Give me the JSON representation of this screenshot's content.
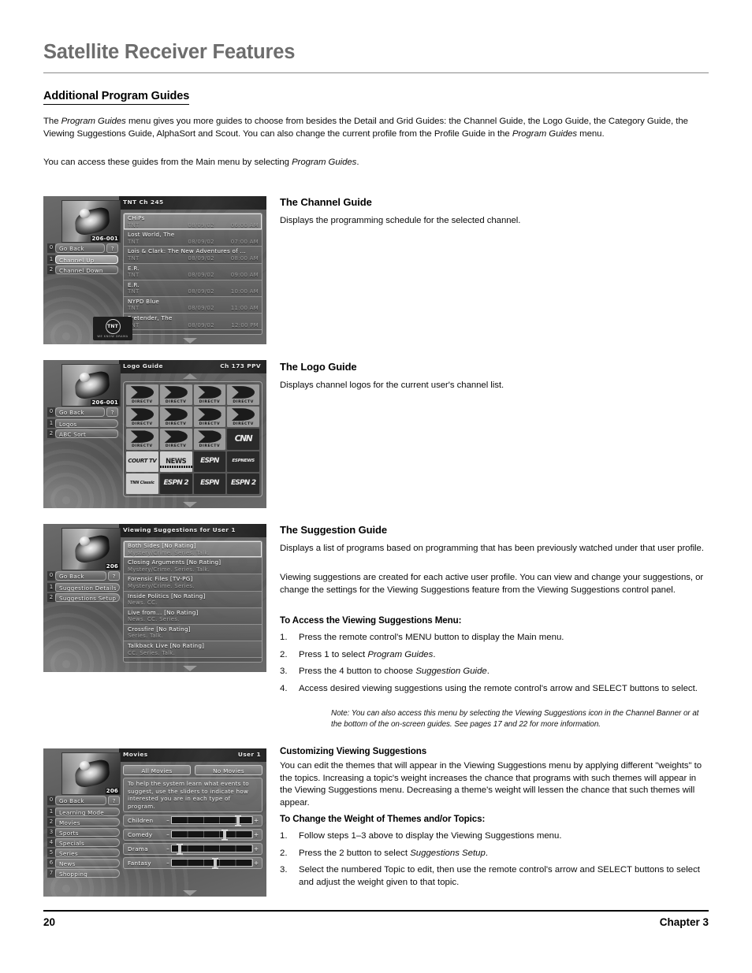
{
  "document": {
    "chapter_title": "Satellite Receiver Features",
    "section_heading": "Additional Program Guides",
    "intro_p1_a": "The ",
    "intro_p1_i1": "Program Guides",
    "intro_p1_b": " menu gives you more guides to choose from besides the Detail and Grid Guides: the Channel Guide, the Logo Guide, the Category Guide, the Viewing Suggestions Guide, AlphaSort and Scout. You can also change the current profile from the Profile Guide in the ",
    "intro_p1_i2": "Program Guides",
    "intro_p1_c": " menu.",
    "intro_p2_a": "You can access these guides from the Main menu by selecting ",
    "intro_p2_i": "Program Guides",
    "intro_p2_b": ".",
    "footer_page": "20",
    "footer_chapter": "Chapter 3"
  },
  "sections": {
    "channel_guide": {
      "heading": "The Channel Guide",
      "body": "Displays the programming schedule for the selected channel."
    },
    "logo_guide": {
      "heading": "The Logo Guide",
      "body": "Displays channel logos for the current user's channel list."
    },
    "suggestion_guide": {
      "heading": "The Suggestion Guide",
      "p1": "Displays a list of programs based on programming that has been previously watched under that user profile.",
      "p2": "Viewing suggestions are created for each active user profile. You can view and change your suggestions, or change the settings for the Viewing Suggestions feature from the Viewing Suggestions control panel.",
      "steps_heading": "To Access the Viewing Suggestions Menu:",
      "steps": [
        {
          "num": "1.",
          "a": "Press the remote control's MENU button to display the Main menu.",
          "i": "",
          "b": ""
        },
        {
          "num": "2.",
          "a": "Press 1 to select ",
          "i": "Program Guides",
          "b": "."
        },
        {
          "num": "3.",
          "a": "Press the 4 button to choose ",
          "i": "Suggestion Guide",
          "b": "."
        },
        {
          "num": "4.",
          "a": "Access desired viewing suggestions using the remote control's arrow and SELECT buttons to select.",
          "i": "",
          "b": ""
        }
      ],
      "note": "Note: You can also access this menu by selecting the Viewing Suggestions icon in the Channel Banner or at the bottom of the on-screen guides. See pages 17 and 22 for more information."
    },
    "customizing": {
      "heading": "Customizing Viewing Suggestions",
      "p1": "You can edit the themes that will appear in the Viewing Suggestions menu by applying different \"weights\" to the topics. Increasing a topic's weight increases the chance that programs with such themes will appear in the Viewing Suggestions menu. Decreasing a theme's weight will lessen the chance that such themes will appear.",
      "steps_heading": "To Change the Weight of Themes and/or Topics:",
      "steps": [
        {
          "num": "1.",
          "a": "Follow steps 1–3 above to display the Viewing Suggestions menu.",
          "i": "",
          "b": ""
        },
        {
          "num": "2.",
          "a": "Press the 2 button to select ",
          "i": "Suggestions Setup",
          "b": "."
        },
        {
          "num": "3.",
          "a": "Select the numbered Topic to edit, then use the remote control's arrow and SELECT buttons to select and adjust the weight given to that topic.",
          "i": "",
          "b": ""
        }
      ]
    }
  },
  "screens": {
    "channel_guide": {
      "title": "TNT Ch 245",
      "title_right": "",
      "thumb_number": "206-001",
      "menu": [
        {
          "num": "0",
          "label": "Go Back",
          "help": "?",
          "selected": false,
          "arrow": false
        },
        {
          "num": "1",
          "label": "Channel Up",
          "help": "",
          "selected": true,
          "arrow": false
        },
        {
          "num": "2",
          "label": "Channel Down",
          "help": "",
          "selected": false,
          "arrow": false
        }
      ],
      "programs": [
        {
          "title": "CHiPs",
          "channel": "TNT",
          "date": "08/09/02",
          "time": "06:00 AM"
        },
        {
          "title": "Lost World, The",
          "channel": "TNT",
          "date": "08/09/02",
          "time": "07:00 AM"
        },
        {
          "title": "Lois & Clark: The New Adventures of ...",
          "channel": "TNT",
          "date": "08/09/02",
          "time": "08:00 AM"
        },
        {
          "title": "E.R.",
          "channel": "TNT",
          "date": "08/09/02",
          "time": "09:00 AM"
        },
        {
          "title": "E.R.",
          "channel": "TNT",
          "date": "08/09/02",
          "time": "10:00 AM"
        },
        {
          "title": "NYPD Blue",
          "channel": "TNT",
          "date": "08/09/02",
          "time": "11:00 AM"
        },
        {
          "title": "Pretender, The",
          "channel": "TNT",
          "date": "08/09/02",
          "time": "12:00 PM"
        }
      ],
      "badge": {
        "ring": "TNT",
        "sub": "WE KNOW DRAMA"
      }
    },
    "logo_guide": {
      "title": "Logo Guide",
      "title_right": "Ch 173 PPV",
      "thumb_number": "206-001",
      "menu": [
        {
          "num": "0",
          "label": "Go Back",
          "help": "?",
          "selected": false,
          "arrow": false
        },
        {
          "num": "1",
          "label": "Logos",
          "help": "",
          "selected": false,
          "arrow": true
        },
        {
          "num": "2",
          "label": "ABC Sort",
          "help": "",
          "selected": false,
          "arrow": false
        }
      ],
      "logos": [
        "DIRECTV",
        "DIRECTV",
        "DIRECTV",
        "DIRECTV",
        "DIRECTV",
        "DIRECTV",
        "DIRECTV",
        "DIRECTV",
        "DIRECTV",
        "DIRECTV",
        "DIRECTV",
        "CNN",
        "COURT TV",
        "CNN Headline NEWS",
        "ESPN",
        "ESPNEWS",
        "TNN Classic",
        "ESPN 2",
        "ESPN",
        "ESPN 2"
      ]
    },
    "suggestion_guide": {
      "title": "Viewing Suggestions for User 1",
      "title_right": "",
      "thumb_number": "206",
      "menu": [
        {
          "num": "0",
          "label": "Go Back",
          "help": "?",
          "selected": false,
          "arrow": false
        },
        {
          "num": "1",
          "label": "Suggestion Details",
          "help": "",
          "selected": false,
          "arrow": true
        },
        {
          "num": "2",
          "label": "Suggestions Setup",
          "help": "",
          "selected": false,
          "arrow": true
        }
      ],
      "programs": [
        {
          "title": "Both Sides [No Rating]",
          "sub": "Mystery/Crime. Series. Talk."
        },
        {
          "title": "Closing Arguments [No Rating]",
          "sub": "Mystery/Crime. Series. Talk."
        },
        {
          "title": "Forensic Files [TV-PG]",
          "sub": "Mystery/Crime. Series."
        },
        {
          "title": "Inside Politics [No Rating]",
          "sub": "News. CC."
        },
        {
          "title": "Live from... [No Rating]",
          "sub": "News. CC. Series."
        },
        {
          "title": "Crossfire [No Rating]",
          "sub": "Series. Talk."
        },
        {
          "title": "Talkback Live [No Rating]",
          "sub": "CC. Series. Talk."
        }
      ]
    },
    "suggestions_setup": {
      "title": "Movies",
      "title_right": "User 1",
      "thumb_number": "206",
      "menu": [
        {
          "num": "0",
          "label": "Go Back",
          "help": "?",
          "selected": false,
          "arrow": false
        },
        {
          "num": "1",
          "label": "Learning Mode",
          "help": "",
          "selected": false,
          "arrow": true
        },
        {
          "num": "2",
          "label": "Movies",
          "help": "",
          "selected": false,
          "arrow": true
        },
        {
          "num": "3",
          "label": "Sports",
          "help": "",
          "selected": false,
          "arrow": true
        },
        {
          "num": "4",
          "label": "Specials",
          "help": "",
          "selected": false,
          "arrow": true
        },
        {
          "num": "5",
          "label": "Series",
          "help": "",
          "selected": false,
          "arrow": true
        },
        {
          "num": "6",
          "label": "News",
          "help": "",
          "selected": false,
          "arrow": true
        },
        {
          "num": "7",
          "label": "Shopping",
          "help": "",
          "selected": false,
          "arrow": true
        }
      ],
      "buttons": [
        "All Movies",
        "No Movies"
      ],
      "description": "To help the system learn what events to suggest, use the sliders to indicate how interested you are in each type of program.",
      "sliders": [
        {
          "label": "Children",
          "minus": "–",
          "plus": "+",
          "value": 82
        },
        {
          "label": "Comedy",
          "minus": "–",
          "plus": "+",
          "value": 66
        },
        {
          "label": "Drama",
          "minus": "–",
          "plus": "+",
          "value": 10
        },
        {
          "label": "Fantasy",
          "minus": "–",
          "plus": "+",
          "value": 54
        }
      ]
    }
  }
}
